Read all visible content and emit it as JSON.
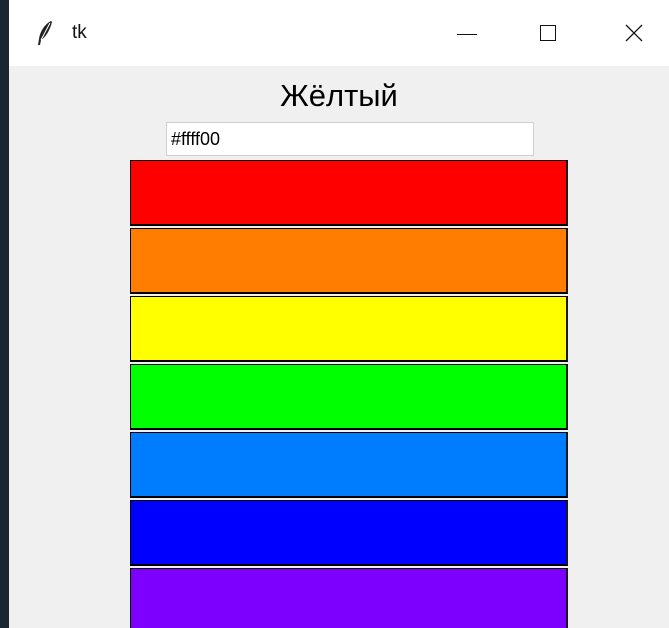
{
  "window": {
    "title": "tk",
    "app_icon": "feather-icon",
    "controls": {
      "minimize_icon": "minimize-icon",
      "maximize_icon": "maximize-icon",
      "close_icon": "close-icon"
    }
  },
  "main": {
    "color_name": "Жёлтый",
    "hex_value": "#ffff00"
  },
  "stripes": [
    {
      "id": "red",
      "color": "#ff0000"
    },
    {
      "id": "orange",
      "color": "#ff7d00"
    },
    {
      "id": "yellow",
      "color": "#ffff00"
    },
    {
      "id": "green",
      "color": "#00ff00"
    },
    {
      "id": "light-blue",
      "color": "#007dff"
    },
    {
      "id": "blue",
      "color": "#0000ff"
    },
    {
      "id": "violet",
      "color": "#7d00ff"
    }
  ]
}
